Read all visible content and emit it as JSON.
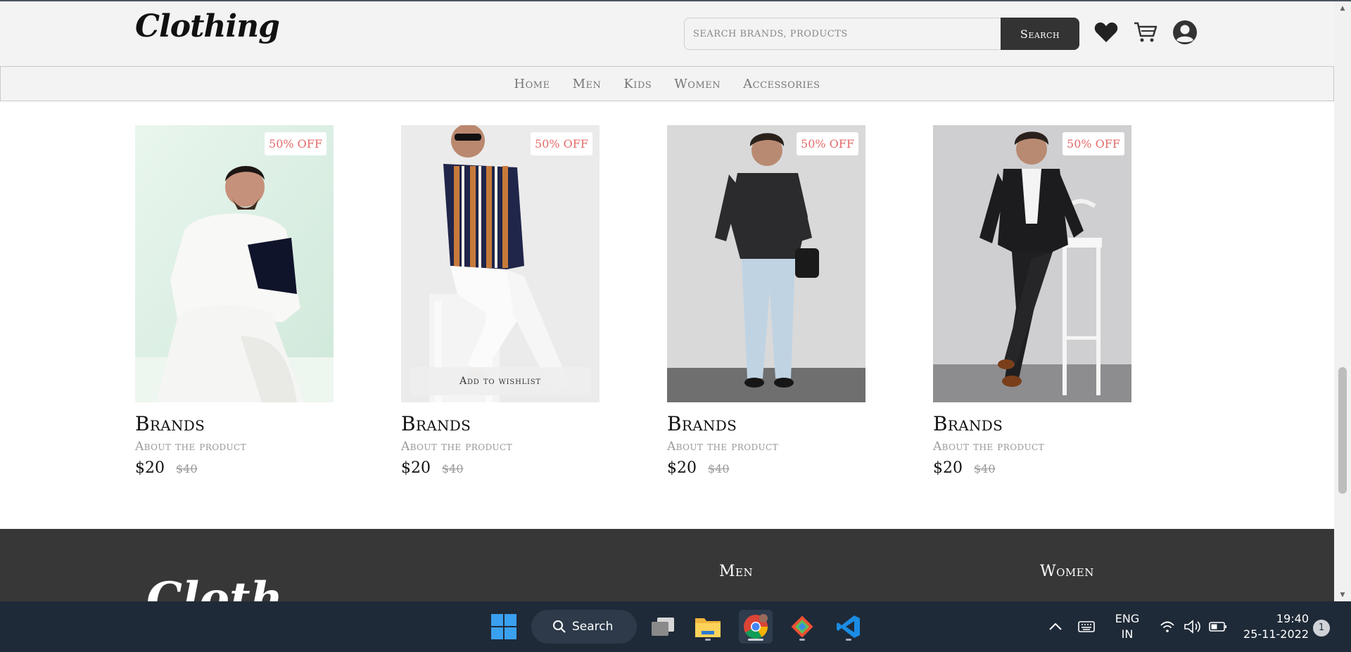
{
  "header": {
    "logo": "Clothing",
    "search_placeholder": "SEARCH BRANDS, PRODUCTS",
    "search_button": "Search",
    "icons": [
      "heart-icon",
      "cart-icon",
      "user-icon"
    ]
  },
  "nav": {
    "items": [
      "Home",
      "Men",
      "Kids",
      "Women",
      "Accessories"
    ]
  },
  "products": [
    {
      "discount": "50% OFF",
      "brand": "Brands",
      "about": "About the product",
      "price": "$20",
      "old_price": "$40",
      "image": "man in white shirt and jeans seated"
    },
    {
      "discount": "50% OFF",
      "brand": "Brands",
      "about": "About the product",
      "price": "$20",
      "old_price": "$40",
      "image": "man in striped shirt on stool",
      "wishlist": "Add to wishlist"
    },
    {
      "discount": "50% OFF",
      "brand": "Brands",
      "about": "About the product",
      "price": "$20",
      "old_price": "$40",
      "image": "man in black shirt with bag"
    },
    {
      "discount": "50% OFF",
      "brand": "Brands",
      "about": "About the product",
      "price": "$20",
      "old_price": "$40",
      "image": "man in black suit by white chair"
    }
  ],
  "footer": {
    "logo": "Cloth",
    "headings": [
      "Men",
      "Women"
    ]
  },
  "taskbar": {
    "search_label": "Search",
    "language": "ENG",
    "region": "IN",
    "time": "19:40",
    "date": "25-11-2022",
    "notifications": "1",
    "apps": [
      "windows-start-icon",
      "task-view-icon",
      "file-explorer-icon",
      "chrome-icon",
      "git-icon",
      "vscode-icon"
    ]
  },
  "colors": {
    "header_bg": "#f3f3f3",
    "footer_bg": "#373737",
    "button_bg": "#333333",
    "discount_text": "#e46a6a",
    "taskbar_bg": "#1f2a38"
  }
}
